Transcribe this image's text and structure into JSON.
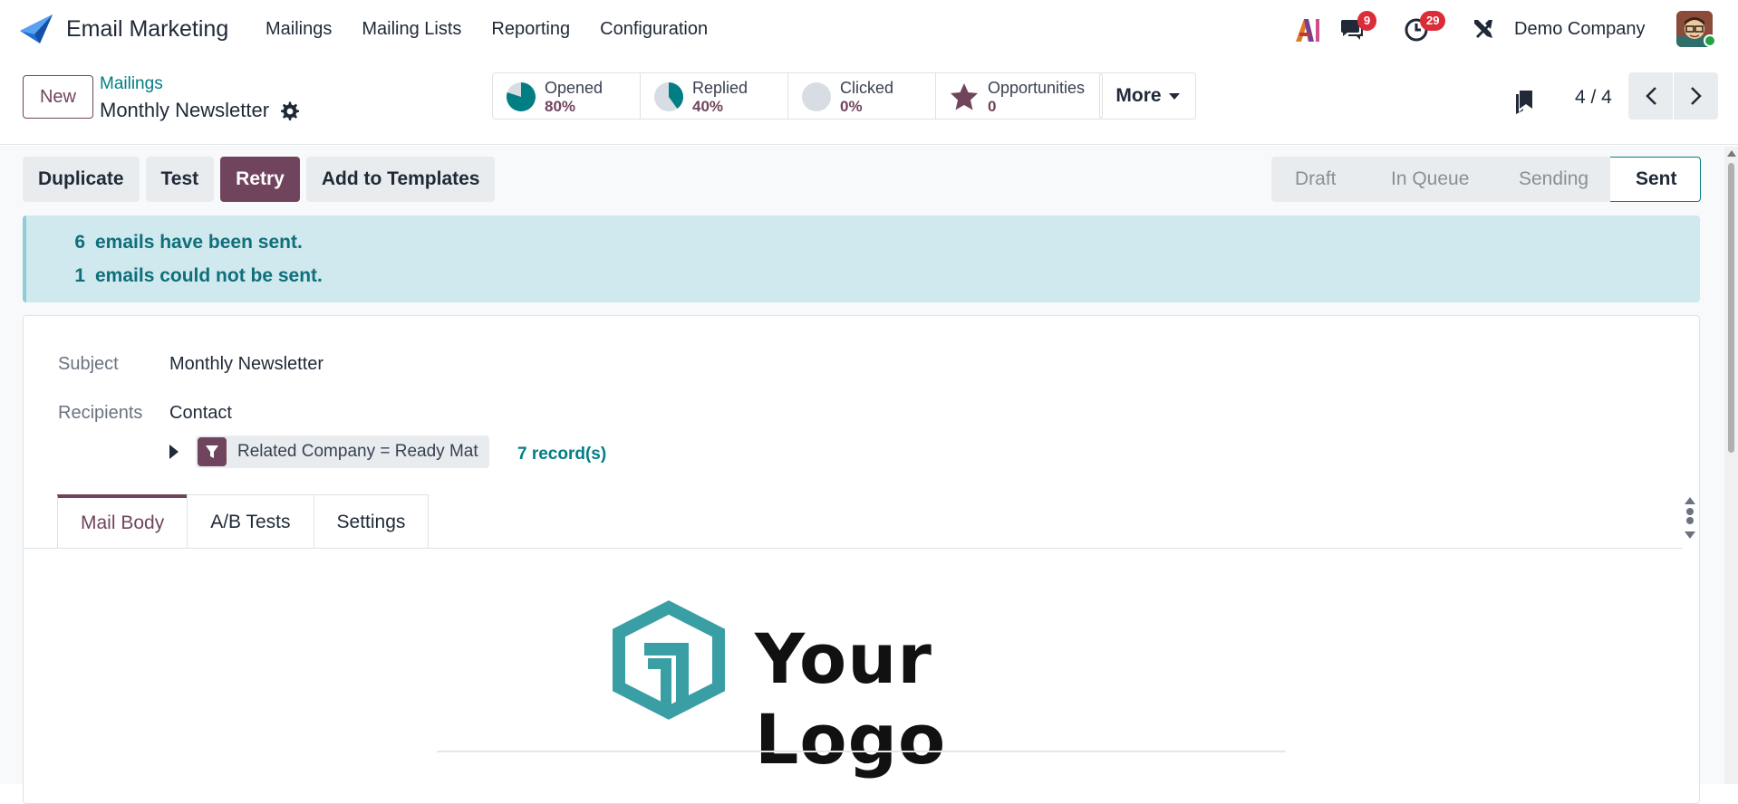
{
  "navbar": {
    "app_name": "Email Marketing",
    "menu": [
      "Mailings",
      "Mailing Lists",
      "Reporting",
      "Configuration"
    ],
    "messages_count": "9",
    "activities_count": "29",
    "company": "Demo Company",
    "icons": [
      "app-logo-icon",
      "ai-icon",
      "chat-icon",
      "clock-icon",
      "tools-icon",
      "avatar"
    ]
  },
  "control": {
    "new_label": "New",
    "breadcrumb_parent": "Mailings",
    "record_title": "Monthly Newsletter",
    "stats": [
      {
        "label": "Opened",
        "value": "80%",
        "fraction": 0.8
      },
      {
        "label": "Replied",
        "value": "40%",
        "fraction": 0.4
      },
      {
        "label": "Clicked",
        "value": "0%",
        "fraction": 0
      },
      {
        "label": "Opportunities",
        "value": "0"
      }
    ],
    "more_label": "More",
    "pager": "4 / 4"
  },
  "actions": {
    "buttons": [
      "Duplicate",
      "Test",
      "Retry",
      "Add to Templates"
    ],
    "stages": [
      "Draft",
      "In Queue",
      "Sending",
      "Sent"
    ],
    "current_stage": "Sent"
  },
  "alert": {
    "sent_count": "6",
    "sent_text": "emails have been sent.",
    "failed_count": "1",
    "failed_text": "emails could not be sent."
  },
  "form": {
    "subject_label": "Subject",
    "subject_value": "Monthly Newsletter",
    "recipients_label": "Recipients",
    "recipients_value": "Contact",
    "domain_text": "Related Company = Ready Mat",
    "records_link": "7 record(s)",
    "tabs": [
      "Mail Body",
      "A/B Tests",
      "Settings"
    ],
    "active_tab": "Mail Body"
  },
  "mail_body": {
    "logo_text": "Your Logo"
  },
  "colors": {
    "brand": "#71445d",
    "accent": "#017e84",
    "alert_bg": "#cfe9ee"
  }
}
